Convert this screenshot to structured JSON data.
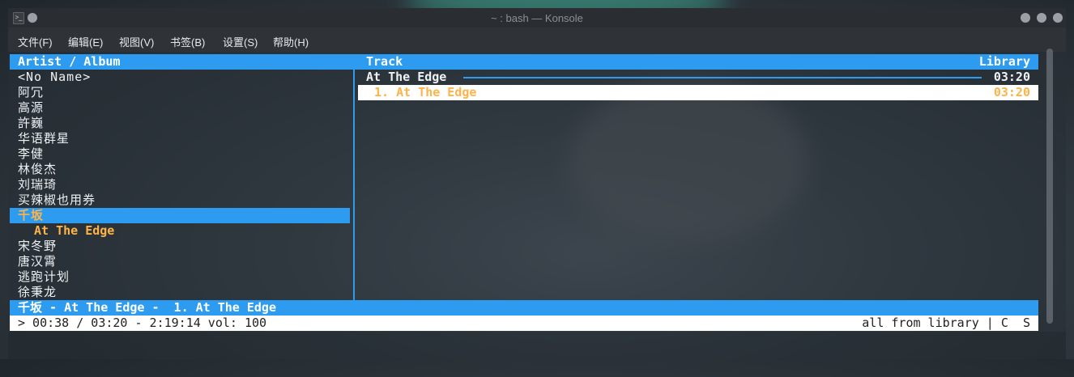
{
  "window": {
    "title": "~ : bash — Konsole",
    "app_icon": "terminal-icon"
  },
  "menubar": [
    "文件(F)",
    "编辑(E)",
    "视图(V)",
    "书签(B)",
    "设置(S)",
    "帮助(H)"
  ],
  "panes": {
    "left_header": "Artist / Album",
    "track_header": "Track",
    "library_header": "Library"
  },
  "artists": [
    "<No Name>",
    "阿冗",
    "高源",
    "許巍",
    "华语群星",
    "李健",
    "林俊杰",
    "刘瑞琦",
    "买辣椒也用券"
  ],
  "selected_artist": "千坂",
  "album": "At The Edge",
  "artists_after": [
    "宋冬野",
    "唐汉霄",
    "逃跑计划",
    "徐秉龙"
  ],
  "tracks_pane": {
    "album_title": "At The Edge",
    "album_duration": "03:20",
    "selected_track": "1. At The Edge",
    "selected_track_duration": "03:20"
  },
  "status": {
    "now_playing": "千坂 - At The Edge -  1. At The Edge",
    "progress": "> 00:38 / 03:20 - 2:19:14 vol: 100",
    "right": "all from library | C  S"
  },
  "colors": {
    "accent": "#2d9cf0",
    "highlight": "#ffb347"
  }
}
